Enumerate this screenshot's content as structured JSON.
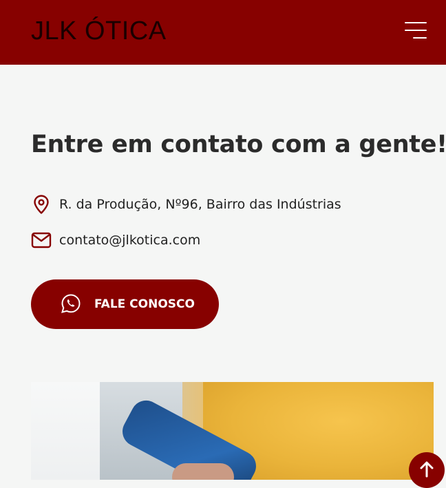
{
  "header": {
    "brand": "JLK ÓTICA",
    "menu_icon": "hamburger-menu-icon"
  },
  "contact": {
    "heading": "Entre em contato com a gente!",
    "address": "R. da Produção, Nº96, Bairro das Indústrias",
    "address_icon": "map-pin-icon",
    "email": "contato@jlkotica.com",
    "email_icon": "envelope-icon",
    "cta_label": "FALE CONOSCO",
    "cta_icon": "whatsapp-icon"
  },
  "scroll_top_icon": "arrow-up-icon",
  "colors": {
    "brand": "#870100",
    "background": "#f5f6f5",
    "text": "#2b2b2b"
  }
}
